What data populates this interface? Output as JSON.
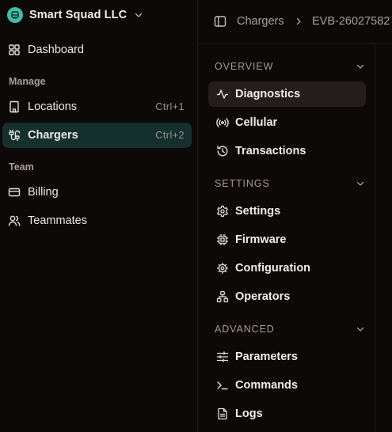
{
  "org": {
    "name": "Smart Squad LLC"
  },
  "sidebar": {
    "dashboard": {
      "label": "Dashboard",
      "icon": "layout-grid-icon"
    },
    "sections": [
      {
        "label": "Manage"
      },
      {
        "label": "Team"
      }
    ],
    "manage_items": [
      {
        "label": "Locations",
        "shortcut": "Ctrl+1",
        "icon": "building-icon",
        "active": false
      },
      {
        "label": "Chargers",
        "shortcut": "Ctrl+2",
        "icon": "cable-icon",
        "active": true
      }
    ],
    "team_items": [
      {
        "label": "Billing",
        "icon": "credit-card-icon"
      },
      {
        "label": "Teammates",
        "icon": "users-icon"
      }
    ]
  },
  "breadcrumb": {
    "items": [
      "Chargers",
      "EVB-26027582"
    ]
  },
  "subnav": {
    "groups": [
      {
        "label": "OVERVIEW",
        "items": [
          {
            "label": "Diagnostics",
            "icon": "activity-icon",
            "active": true
          },
          {
            "label": "Cellular",
            "icon": "signal-icon"
          },
          {
            "label": "Transactions",
            "icon": "history-icon"
          }
        ]
      },
      {
        "label": "SETTINGS",
        "items": [
          {
            "label": "Settings",
            "icon": "gear-icon"
          },
          {
            "label": "Firmware",
            "icon": "chip-icon"
          },
          {
            "label": "Configuration",
            "icon": "cog-icon"
          },
          {
            "label": "Operators",
            "icon": "network-icon"
          }
        ]
      },
      {
        "label": "ADVANCED",
        "items": [
          {
            "label": "Parameters",
            "icon": "sliders-icon"
          },
          {
            "label": "Commands",
            "icon": "terminal-icon"
          },
          {
            "label": "Logs",
            "icon": "file-text-icon"
          }
        ]
      }
    ]
  },
  "colors": {
    "background": "#0d0909",
    "accent": "#3fbfa4",
    "active_sidebar": "#14302c",
    "active_subnav": "#231d1c"
  }
}
